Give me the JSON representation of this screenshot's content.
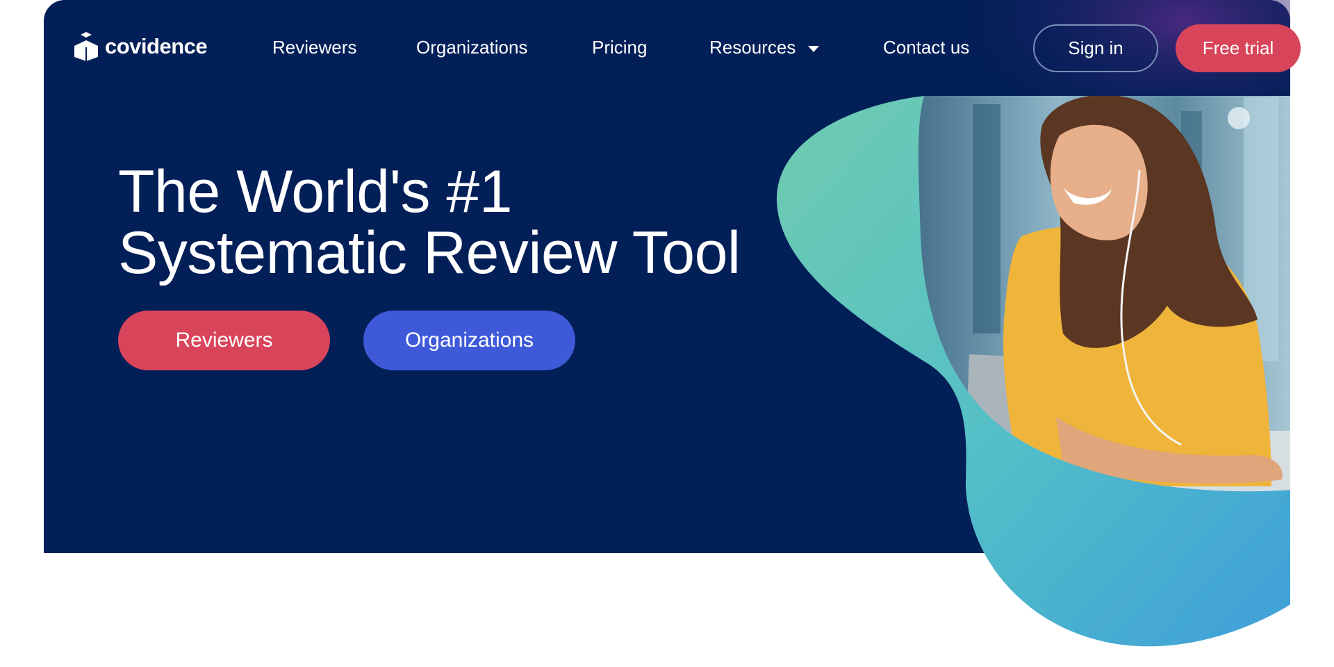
{
  "brand": {
    "name": "covidence",
    "icon": "box-logo-icon"
  },
  "nav": {
    "reviewers": "Reviewers",
    "organizations": "Organizations",
    "pricing": "Pricing",
    "resources": "Resources",
    "contact": "Contact us",
    "signin": "Sign in",
    "trial": "Free trial"
  },
  "hero": {
    "headline_line1": "The World's #1",
    "headline_line2": "Systematic Review Tool",
    "cta_reviewers": "Reviewers",
    "cta_organizations": "Organizations"
  },
  "colors": {
    "navy": "#021f57",
    "accent_red": "#d8455a",
    "accent_blue": "#3f5ad8",
    "teal": "#63c7b7",
    "sky": "#3fa2d8"
  }
}
